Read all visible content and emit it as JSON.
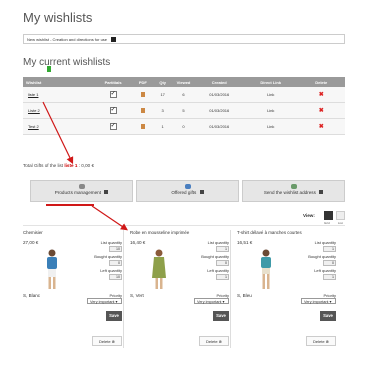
{
  "page": {
    "title": "My wishlists",
    "new_wishlist_label": "New wishlist - Creation and directions for use",
    "current_title": "My current wishlists"
  },
  "table": {
    "headers": [
      "Wishlist",
      "Partitials",
      "PDF",
      "Qty",
      "Viewed",
      "Created",
      "Direct Link",
      "Delete"
    ],
    "rows": [
      {
        "name": "liste 1",
        "qty": "17",
        "viewed": "6",
        "created": "01/03/2016",
        "link": "Link"
      },
      {
        "name": "Liste 2",
        "qty": "3",
        "viewed": "5",
        "created": "01/03/2016",
        "link": "Link"
      },
      {
        "name": "Test 2",
        "qty": "1",
        "viewed": "0",
        "created": "01/03/2016",
        "link": "Link"
      }
    ]
  },
  "total": {
    "prefix": "Total Gifts of the list",
    "list_name": "liste 1",
    "amount": ": 0,00 €"
  },
  "tools": {
    "products": "Products management",
    "offered": "Offered gifts",
    "send": "Send the wishlist address"
  },
  "view": {
    "label": "View:",
    "grid": "Grid",
    "list": "List"
  },
  "products": [
    {
      "name": "Chemisier",
      "price": "27,00 €",
      "list_qty": "10",
      "bought_qty": "0",
      "left_qty": "10",
      "color": "S, Blanc",
      "priority": "Very important",
      "img_color": "#3a7fb8"
    },
    {
      "name": "Robe en mousseline imprimée",
      "price": "16,40 €",
      "list_qty": "1",
      "bought_qty": "0",
      "left_qty": "1",
      "color": "S, Vert",
      "priority": "Very important",
      "img_color": "#8ea04a"
    },
    {
      "name": "T-shirt délavé à manches courtes",
      "price": "16,51 €",
      "list_qty": "1",
      "bought_qty": "0",
      "left_qty": "1",
      "color": "S, Bleu",
      "priority": "Very important",
      "img_color": "#3e9aa8"
    }
  ],
  "labels": {
    "list_quantity": "List quantity",
    "bought_quantity": "Bought quantity",
    "left_quantity": "Left quantity",
    "priority": "Priority",
    "save": "Save",
    "delete": "Delete"
  },
  "colors": {
    "header_bg": "#9a9a9a",
    "annotation_red": "#d01818",
    "delete_red": "#dd2222"
  }
}
